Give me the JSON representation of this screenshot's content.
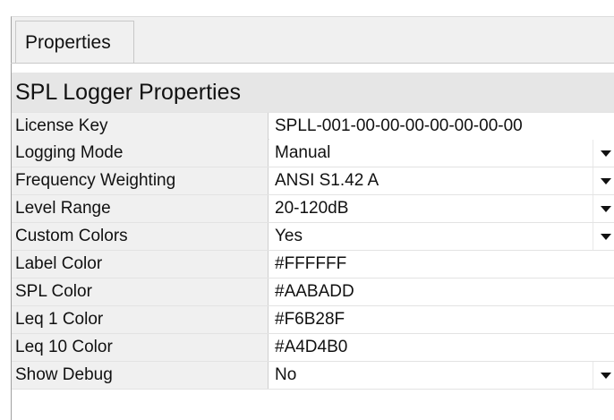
{
  "tabs": [
    {
      "label": "Properties"
    }
  ],
  "section": {
    "title": "SPL Logger Properties"
  },
  "properties": [
    {
      "label": "License Key",
      "value": "SPLL-001-00-00-00-00-00-00-00",
      "dropdown": false
    },
    {
      "label": "Logging Mode",
      "value": "Manual",
      "dropdown": true
    },
    {
      "label": "Frequency Weighting",
      "value": "ANSI S1.42 A",
      "dropdown": true
    },
    {
      "label": "Level Range",
      "value": "20-120dB",
      "dropdown": true
    },
    {
      "label": "Custom Colors",
      "value": "Yes",
      "dropdown": true
    },
    {
      "label": "Label Color",
      "value": "#FFFFFF",
      "dropdown": false
    },
    {
      "label": "SPL Color",
      "value": "#AABADD",
      "dropdown": false
    },
    {
      "label": "Leq 1 Color",
      "value": "#F6B28F",
      "dropdown": false
    },
    {
      "label": "Leq 10 Color",
      "value": "#A4D4B0",
      "dropdown": false
    },
    {
      "label": "Show Debug",
      "value": "No",
      "dropdown": true
    }
  ],
  "icons": {
    "dropdown": "chevron-down-icon"
  },
  "colors": {
    "label_bg": "#F0F0F0",
    "header_bg": "#E6E6E6",
    "value_bg": "#FFFFFF"
  }
}
